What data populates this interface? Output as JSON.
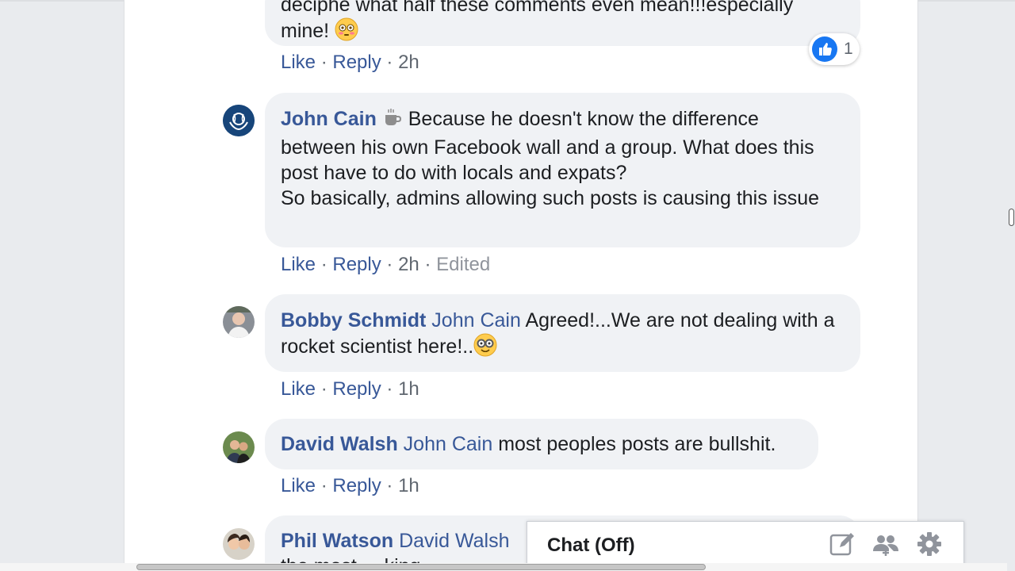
{
  "comments": [
    {
      "text_line1": "deciphe what half these comments even mean!!!especially",
      "text_line2": "mine!",
      "like": "Like",
      "reply": "Reply",
      "time": "2h",
      "reaction_count": "1"
    },
    {
      "author": "John Cain",
      "text_line1": "Because he doesn't know the difference",
      "text_rest": "between his own Facebook wall and a group. What does this post have to do with locals and expats?",
      "text_line4": "So basically, admins allowing such posts is causing this issue",
      "like": "Like",
      "reply": "Reply",
      "time": "2h",
      "edited": "Edited"
    },
    {
      "author": "Bobby Schmidt",
      "mention": "John Cain",
      "text": "Agreed!...We are not dealing with a rocket scientist here!..",
      "like": "Like",
      "reply": "Reply",
      "time": "1h"
    },
    {
      "author": "David Walsh",
      "mention": "John Cain",
      "text": "most peoples posts are bullshit.",
      "like": "Like",
      "reply": "Reply",
      "time": "1h"
    },
    {
      "author": "Phil Watson",
      "mention": "David Walsh",
      "text": "the most ... king"
    }
  ],
  "chat": {
    "title": "Chat (Off)"
  },
  "icons": {
    "compose": "compose-icon",
    "add_people": "add-people-icon",
    "settings": "gear-icon"
  },
  "colors": {
    "link": "#385898",
    "bubble": "#f0f2f5",
    "like_blue": "#1877f2"
  }
}
